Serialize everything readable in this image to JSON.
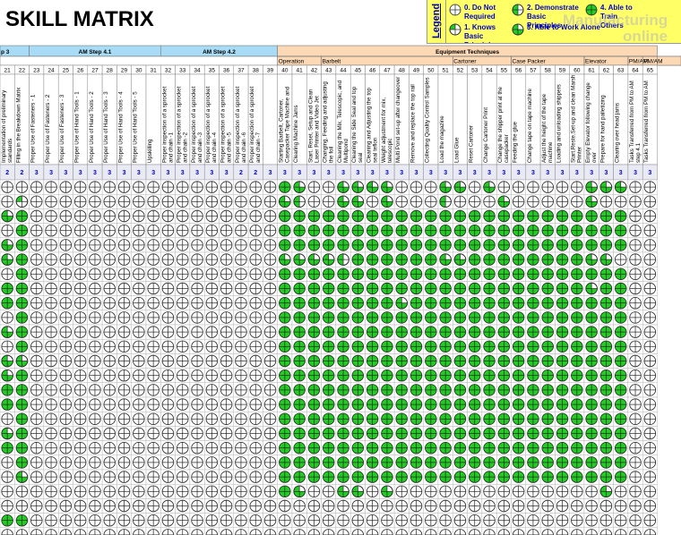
{
  "title": "SKILL MATRIX",
  "legend": {
    "title": "Legend",
    "items": [
      {
        "level": 0,
        "label": "0. Do Not Required"
      },
      {
        "level": 2,
        "label": "2. Demonstrate Basic Principles"
      },
      {
        "level": 4,
        "label": "4. Able to Train Others"
      },
      {
        "level": 1,
        "label": "1. Knows Basic Principles"
      },
      {
        "level": 3,
        "label": "3. Able to Work Alone"
      }
    ]
  },
  "watermark": {
    "line1": "Manufacturing",
    "line2": "online"
  },
  "colors": {
    "green": "#22cc22",
    "header_blue": "#bfe4f6",
    "header_orange": "#fcd8b4",
    "legend_yellow": "#ffff66",
    "level_text": "#0000cc"
  },
  "categories": [
    {
      "label": "p 3",
      "color": "#a8dcf6"
    },
    {
      "label": "AM Step 4.1",
      "color": "#a8dcf6"
    },
    {
      "label": "AM Step 4.2",
      "color": "#a8dcf6"
    },
    {
      "label": "Equipment Techniques",
      "color": "#fcd8b4"
    }
  ],
  "subcategories": [
    {
      "label": "Operation"
    },
    {
      "label": "Barbelt"
    },
    {
      "label": "Cartoner"
    },
    {
      "label": "Case Packer"
    },
    {
      "label": "Elevator"
    },
    {
      "label": "PM/AM"
    },
    {
      "label": "PM/AM"
    }
  ],
  "columns": [
    {
      "num": "21",
      "task": "Implementation of preliminary standards",
      "level": "2"
    },
    {
      "num": "22",
      "task": "Filling in the Breakdown Matrix",
      "level": "2"
    },
    {
      "num": "23",
      "task": "Proper Use of Fasteners - 1",
      "level": "3"
    },
    {
      "num": "24",
      "task": "Proper Use of Fasteners - 2",
      "level": "3"
    },
    {
      "num": "25",
      "task": "Proper Use of Fasteners - 3",
      "level": "3"
    },
    {
      "num": "26",
      "task": "Proper Use of Hand Tools - 1",
      "level": "3"
    },
    {
      "num": "27",
      "task": "Proper Use of Hand Tools - 2",
      "level": "3"
    },
    {
      "num": "28",
      "task": "Proper Use of Hand Tools - 3",
      "level": "3"
    },
    {
      "num": "29",
      "task": "Proper Use of Hand Tools - 4",
      "level": "3"
    },
    {
      "num": "30",
      "task": "Proper Use of Hand Tools - 5",
      "level": "3"
    },
    {
      "num": "31",
      "task": "Upskilling",
      "level": "3"
    },
    {
      "num": "32",
      "task": "Proper inspection of a sprocket and chain -1",
      "level": "3"
    },
    {
      "num": "33",
      "task": "Proper inspection of a sprocket and chain -2",
      "level": "3"
    },
    {
      "num": "34",
      "task": "Proper inspection of a sprocket and chain -3",
      "level": "3"
    },
    {
      "num": "35",
      "task": "Proper inspection of a sprocket and chain -4",
      "level": "3"
    },
    {
      "num": "36",
      "task": "Proper inspection of a sprocket and chain -5",
      "level": "3"
    },
    {
      "num": "37",
      "task": "Proper inspection of a sprocket and chain -6",
      "level": "2"
    },
    {
      "num": "38",
      "task": "Proper inspection of a sprocket and chain -7",
      "level": "2"
    },
    {
      "num": "39",
      "task": "",
      "level": "3"
    },
    {
      "num": "40",
      "task": "Starting Barbelt, Cartoner, Casepacker Tape Machine and",
      "level": "3"
    },
    {
      "num": "41",
      "task": "Clearing Machine Jams",
      "level": "3"
    },
    {
      "num": "42",
      "task": "Start, Reset, Setup and Clean Laser Printer and Video Jet",
      "level": "3"
    },
    {
      "num": "43",
      "task": "Changing, Feeding and adjusting the foil",
      "level": "3"
    },
    {
      "num": "44",
      "task": "Cleaning the Mix, Telescopic, and Multipond",
      "level": "3"
    },
    {
      "num": "45",
      "task": "Cleaning the Side Seal and top seal",
      "level": "3"
    },
    {
      "num": "46",
      "task": "Cleaning and Adjusting the top seal teflon",
      "level": "3"
    },
    {
      "num": "47",
      "task": "Weight adjustment for mix, telescopic",
      "level": "3"
    },
    {
      "num": "48",
      "task": "Multi Pond set-up after changeover",
      "level": "3"
    },
    {
      "num": "49",
      "task": "Remove and replace the top rail",
      "level": "3"
    },
    {
      "num": "50",
      "task": "Collecting Quality Control Samples",
      "level": "3"
    },
    {
      "num": "51",
      "task": "Load the magazine",
      "level": "3"
    },
    {
      "num": "52",
      "task": "Load Glue",
      "level": "3"
    },
    {
      "num": "53",
      "task": "Reset Cartoner",
      "level": "3"
    },
    {
      "num": "54",
      "task": "Change Cartoner Print",
      "level": "3"
    },
    {
      "num": "55",
      "task": "Change the shipper print at the casepacker",
      "level": "3"
    },
    {
      "num": "56",
      "task": "Feeding the glue",
      "level": "3"
    },
    {
      "num": "57",
      "task": "Change tape on tape machine",
      "level": "3"
    },
    {
      "num": "58",
      "task": "Adjust the height of the tape machine",
      "level": "3"
    },
    {
      "num": "59",
      "task": "Loading and unloading shippers",
      "level": "3"
    },
    {
      "num": "60",
      "task": "Start,Reste,Set-up and clean Marsh Printer",
      "level": "3"
    },
    {
      "num": "61",
      "task": "Empty Elevator following change over",
      "level": "3"
    },
    {
      "num": "62",
      "task": "Prepare for hand palletizing",
      "level": "3"
    },
    {
      "num": "63",
      "task": "Clearing over head jams",
      "level": "3"
    },
    {
      "num": "64",
      "task": "Tasks Transferred from PM to AM step 4.1",
      "level": "3"
    },
    {
      "num": "65",
      "task": "Tasks Transferred from PM to AM",
      "level": "3"
    }
  ],
  "matrix": [
    [
      0,
      0,
      0,
      0,
      0,
      0,
      0,
      0,
      0,
      0,
      0,
      0,
      0,
      0,
      0,
      0,
      0,
      0,
      0,
      4,
      3,
      0,
      0,
      3,
      3,
      3,
      3,
      0,
      0,
      0,
      3,
      3,
      0,
      3,
      0,
      0,
      0,
      0,
      0,
      0,
      3,
      3,
      3,
      0,
      0
    ],
    [
      0,
      1,
      0,
      0,
      0,
      0,
      0,
      0,
      0,
      0,
      0,
      0,
      0,
      0,
      0,
      0,
      0,
      0,
      0,
      3,
      2,
      0,
      0,
      3,
      3,
      0,
      3,
      0,
      0,
      0,
      2,
      0,
      0,
      0,
      3,
      0,
      0,
      0,
      0,
      0,
      3,
      0,
      0,
      0,
      0
    ],
    [
      3,
      4,
      0,
      0,
      0,
      0,
      0,
      0,
      0,
      0,
      0,
      0,
      0,
      0,
      0,
      0,
      0,
      0,
      0,
      4,
      4,
      4,
      4,
      4,
      4,
      4,
      4,
      4,
      4,
      4,
      4,
      4,
      4,
      4,
      4,
      4,
      4,
      4,
      4,
      4,
      4,
      4,
      4,
      0,
      0
    ],
    [
      0,
      4,
      0,
      0,
      0,
      0,
      0,
      0,
      0,
      0,
      0,
      0,
      0,
      0,
      0,
      0,
      0,
      0,
      0,
      4,
      4,
      4,
      4,
      4,
      4,
      4,
      4,
      4,
      4,
      4,
      4,
      4,
      4,
      4,
      4,
      4,
      4,
      4,
      4,
      4,
      4,
      4,
      4,
      0,
      0
    ],
    [
      3,
      4,
      0,
      0,
      0,
      0,
      0,
      0,
      0,
      0,
      0,
      0,
      0,
      0,
      0,
      0,
      0,
      0,
      0,
      4,
      4,
      4,
      4,
      4,
      4,
      4,
      4,
      4,
      4,
      4,
      4,
      4,
      4,
      4,
      4,
      4,
      4,
      4,
      4,
      4,
      4,
      4,
      4,
      0,
      0
    ],
    [
      3,
      4,
      0,
      0,
      0,
      0,
      0,
      0,
      0,
      0,
      0,
      0,
      0,
      0,
      0,
      0,
      0,
      0,
      0,
      3,
      3,
      3,
      3,
      2,
      4,
      4,
      4,
      4,
      4,
      4,
      3,
      3,
      4,
      4,
      4,
      4,
      4,
      4,
      4,
      4,
      3,
      3,
      0,
      0,
      0
    ],
    [
      0,
      4,
      0,
      0,
      0,
      0,
      0,
      0,
      0,
      0,
      0,
      0,
      0,
      0,
      0,
      0,
      0,
      0,
      0,
      4,
      4,
      4,
      4,
      4,
      4,
      4,
      4,
      4,
      4,
      4,
      4,
      4,
      4,
      4,
      4,
      4,
      4,
      4,
      4,
      4,
      4,
      4,
      4,
      0,
      0
    ],
    [
      4,
      4,
      0,
      0,
      0,
      0,
      0,
      0,
      0,
      0,
      0,
      0,
      0,
      0,
      0,
      0,
      0,
      0,
      0,
      4,
      4,
      4,
      4,
      4,
      4,
      4,
      4,
      4,
      4,
      4,
      4,
      4,
      4,
      4,
      4,
      4,
      4,
      4,
      4,
      4,
      3,
      4,
      4,
      0,
      0
    ],
    [
      4,
      4,
      0,
      0,
      0,
      0,
      0,
      0,
      0,
      0,
      0,
      0,
      0,
      0,
      0,
      0,
      0,
      0,
      0,
      4,
      4,
      4,
      4,
      4,
      4,
      4,
      4,
      3,
      4,
      4,
      4,
      4,
      4,
      4,
      4,
      4,
      4,
      4,
      4,
      4,
      4,
      4,
      4,
      0,
      0
    ],
    [
      0,
      4,
      0,
      0,
      0,
      0,
      0,
      0,
      0,
      0,
      0,
      0,
      0,
      0,
      0,
      0,
      0,
      0,
      0,
      4,
      4,
      4,
      4,
      4,
      4,
      4,
      4,
      4,
      4,
      4,
      4,
      4,
      4,
      4,
      4,
      4,
      4,
      4,
      4,
      4,
      4,
      4,
      4,
      0,
      0
    ],
    [
      3,
      4,
      0,
      0,
      0,
      0,
      0,
      0,
      0,
      0,
      0,
      0,
      0,
      0,
      0,
      0,
      0,
      0,
      0,
      4,
      4,
      4,
      4,
      4,
      4,
      4,
      4,
      4,
      4,
      4,
      4,
      4,
      4,
      4,
      4,
      4,
      4,
      4,
      4,
      4,
      4,
      4,
      4,
      0,
      0
    ],
    [
      0,
      4,
      0,
      0,
      0,
      0,
      0,
      0,
      0,
      0,
      0,
      0,
      0,
      0,
      0,
      0,
      0,
      0,
      0,
      4,
      4,
      4,
      4,
      4,
      4,
      4,
      4,
      4,
      4,
      4,
      4,
      4,
      4,
      4,
      4,
      4,
      4,
      4,
      4,
      4,
      4,
      4,
      4,
      0,
      0
    ],
    [
      3,
      3,
      0,
      0,
      0,
      0,
      0,
      0,
      0,
      0,
      0,
      0,
      0,
      0,
      0,
      0,
      0,
      0,
      0,
      4,
      4,
      4,
      4,
      4,
      4,
      4,
      4,
      4,
      4,
      4,
      4,
      4,
      4,
      4,
      4,
      4,
      4,
      4,
      4,
      4,
      4,
      4,
      4,
      0,
      0
    ],
    [
      3,
      4,
      0,
      0,
      0,
      0,
      0,
      0,
      0,
      0,
      0,
      0,
      0,
      0,
      0,
      0,
      0,
      0,
      0,
      4,
      4,
      4,
      4,
      4,
      4,
      4,
      4,
      4,
      4,
      4,
      4,
      4,
      4,
      4,
      4,
      4,
      4,
      4,
      4,
      4,
      4,
      4,
      4,
      0,
      0
    ],
    [
      4,
      4,
      0,
      0,
      0,
      0,
      0,
      0,
      0,
      0,
      0,
      0,
      0,
      0,
      0,
      0,
      0,
      0,
      0,
      4,
      4,
      4,
      4,
      4,
      4,
      4,
      4,
      4,
      4,
      4,
      4,
      4,
      4,
      4,
      4,
      4,
      4,
      4,
      4,
      4,
      4,
      4,
      4,
      0,
      0
    ],
    [
      4,
      4,
      0,
      0,
      0,
      0,
      0,
      0,
      0,
      0,
      0,
      0,
      0,
      0,
      0,
      0,
      0,
      0,
      0,
      4,
      4,
      4,
      4,
      4,
      4,
      4,
      4,
      4,
      4,
      4,
      4,
      4,
      4,
      4,
      4,
      4,
      4,
      4,
      4,
      4,
      4,
      4,
      4,
      0,
      0
    ],
    [
      0,
      4,
      0,
      0,
      0,
      0,
      0,
      0,
      0,
      0,
      0,
      0,
      0,
      0,
      0,
      0,
      0,
      0,
      0,
      4,
      4,
      4,
      4,
      4,
      4,
      4,
      4,
      4,
      4,
      4,
      4,
      4,
      4,
      4,
      4,
      4,
      4,
      4,
      4,
      4,
      4,
      4,
      4,
      0,
      0
    ],
    [
      3,
      4,
      0,
      0,
      0,
      0,
      0,
      0,
      0,
      0,
      0,
      0,
      0,
      0,
      0,
      0,
      0,
      0,
      0,
      4,
      4,
      4,
      4,
      4,
      4,
      4,
      4,
      4,
      4,
      4,
      4,
      4,
      4,
      4,
      4,
      4,
      4,
      4,
      4,
      4,
      4,
      4,
      4,
      0,
      0
    ],
    [
      4,
      4,
      0,
      0,
      0,
      0,
      0,
      0,
      0,
      0,
      0,
      0,
      0,
      0,
      0,
      0,
      0,
      0,
      0,
      4,
      4,
      4,
      4,
      4,
      4,
      4,
      4,
      4,
      4,
      4,
      4,
      4,
      4,
      4,
      4,
      4,
      4,
      4,
      4,
      4,
      4,
      4,
      4,
      0,
      0
    ],
    [
      0,
      4,
      0,
      0,
      0,
      0,
      0,
      0,
      0,
      0,
      0,
      0,
      0,
      0,
      0,
      0,
      0,
      0,
      0,
      4,
      4,
      4,
      4,
      4,
      4,
      4,
      4,
      4,
      4,
      4,
      4,
      4,
      4,
      4,
      4,
      4,
      4,
      4,
      4,
      4,
      4,
      4,
      4,
      0,
      0
    ],
    [
      0,
      3,
      0,
      0,
      0,
      0,
      0,
      0,
      0,
      0,
      0,
      0,
      0,
      0,
      0,
      0,
      0,
      0,
      0,
      4,
      4,
      4,
      4,
      4,
      4,
      4,
      4,
      4,
      4,
      4,
      4,
      4,
      4,
      4,
      4,
      4,
      4,
      4,
      4,
      4,
      4,
      4,
      4,
      0,
      0
    ],
    [
      0,
      0,
      0,
      0,
      0,
      0,
      0,
      0,
      0,
      0,
      0,
      0,
      0,
      0,
      0,
      0,
      0,
      0,
      0,
      4,
      3,
      0,
      0,
      3,
      3,
      0,
      3,
      0,
      0,
      0,
      0,
      0,
      0,
      0,
      0,
      0,
      0,
      0,
      0,
      0,
      0,
      3,
      0,
      0,
      0
    ],
    [
      0,
      0,
      0,
      0,
      0,
      0,
      0,
      0,
      0,
      0,
      0,
      0,
      0,
      0,
      0,
      0,
      0,
      0,
      0,
      0,
      0,
      0,
      0,
      0,
      0,
      0,
      0,
      0,
      0,
      0,
      0,
      0,
      0,
      0,
      0,
      0,
      0,
      0,
      0,
      0,
      0,
      0,
      0,
      0,
      0
    ],
    [
      4,
      4,
      0,
      0,
      0,
      0,
      0,
      0,
      0,
      0,
      0,
      0,
      0,
      0,
      0,
      0,
      0,
      0,
      0,
      0,
      0,
      0,
      0,
      0,
      0,
      0,
      0,
      0,
      0,
      0,
      0,
      0,
      0,
      0,
      0,
      0,
      0,
      0,
      0,
      0,
      0,
      0,
      0,
      0,
      0
    ],
    [
      0,
      0,
      0,
      0,
      0,
      0,
      0,
      0,
      0,
      0,
      0,
      0,
      0,
      0,
      0,
      0,
      0,
      0,
      0,
      0,
      0,
      0,
      0,
      0,
      0,
      0,
      0,
      0,
      0,
      0,
      0,
      0,
      0,
      0,
      0,
      0,
      0,
      0,
      0,
      0,
      0,
      0,
      0,
      0,
      0
    ]
  ]
}
